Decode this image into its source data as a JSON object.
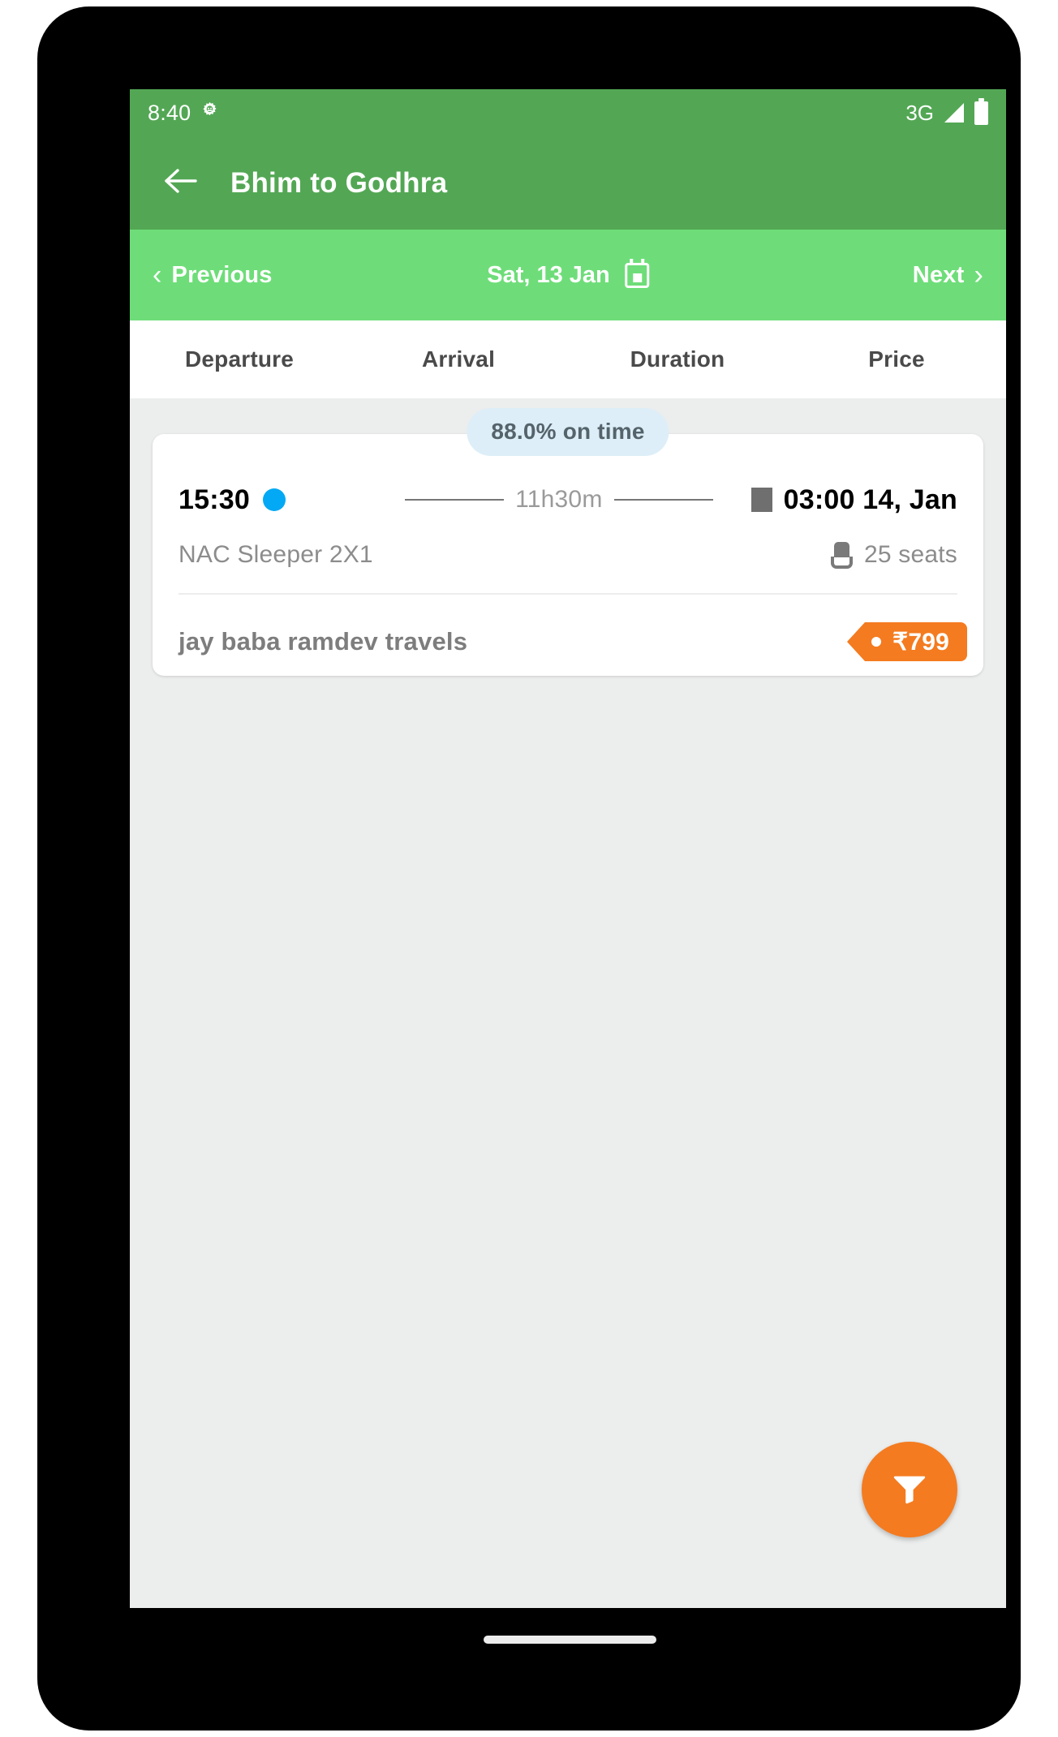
{
  "status_bar": {
    "clock": "8:40",
    "gear_icon": "gear-icon",
    "network": "3G",
    "signal_icon": "signal-triangle-icon",
    "battery_icon": "battery-full-icon"
  },
  "app_bar": {
    "back_icon": "back-arrow-icon",
    "title": "Bhim to Godhra",
    "background_color": "#53a754"
  },
  "date_nav": {
    "previous_label": "Previous",
    "previous_chevron": "chevron-left-icon",
    "date_label": "Sat, 13 Jan",
    "calendar_icon": "calendar-icon",
    "next_label": "Next",
    "next_chevron": "chevron-right-icon",
    "background_color": "#6edd79"
  },
  "sort_tabs": [
    {
      "label": "Departure"
    },
    {
      "label": "Arrival"
    },
    {
      "label": "Duration"
    },
    {
      "label": "Price"
    }
  ],
  "results": {
    "ontime_badge": "88.0% on time",
    "ontime_badge_bg": "#ddeef8",
    "bus": {
      "departure_time": "15:30",
      "departure_dot_color": "#03a9f4",
      "duration": "11h30m",
      "arrival_time": "03:00 14, Jan",
      "arrival_marker_color": "#6f6f6f",
      "bus_type": "NAC Sleeper 2X1",
      "seats": "25 seats",
      "seat_icon": "seat-icon",
      "operator": "jay baba ramdev travels",
      "price": "₹799",
      "price_tag_color": "#f47b20"
    }
  },
  "filter_fab": {
    "icon": "filter-funnel-icon",
    "color": "#f47b20"
  }
}
